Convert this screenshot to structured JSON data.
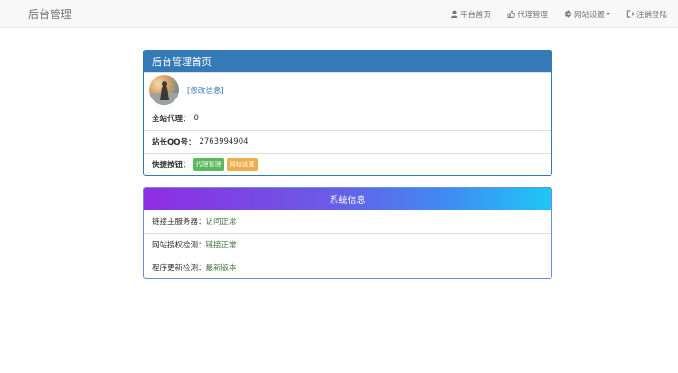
{
  "navbar": {
    "brand": "后台管理",
    "items": [
      {
        "label": "平台首页",
        "icon": "user-icon"
      },
      {
        "label": "代理管理",
        "icon": "thumbs-up-icon"
      },
      {
        "label": "网站设置",
        "icon": "gear-icon",
        "dropdown": true
      },
      {
        "label": "注销登陆",
        "icon": "logout-icon"
      }
    ]
  },
  "admin_panel": {
    "title": "后台管理首页",
    "edit_link": "[修改信息]",
    "agents_label": "全站代理：",
    "agents_value": "0",
    "qq_label": "站长QQ号：",
    "qq_value": "2763994904",
    "shortcuts_label": "快捷按钮：",
    "btn_agent": "代理管理",
    "btn_site": "网站设置"
  },
  "system_panel": {
    "title": "系统信息",
    "rows": [
      {
        "label": "链接主服务器：",
        "status": "访问正常"
      },
      {
        "label": "网站授权检测：",
        "status": "链接正常"
      },
      {
        "label": "程序更新检测：",
        "status": "最新版本"
      }
    ]
  },
  "colors": {
    "primary": "#337ab7",
    "success": "#5cb85c",
    "warning": "#f0ad4e",
    "status_text": "#3c763d"
  }
}
